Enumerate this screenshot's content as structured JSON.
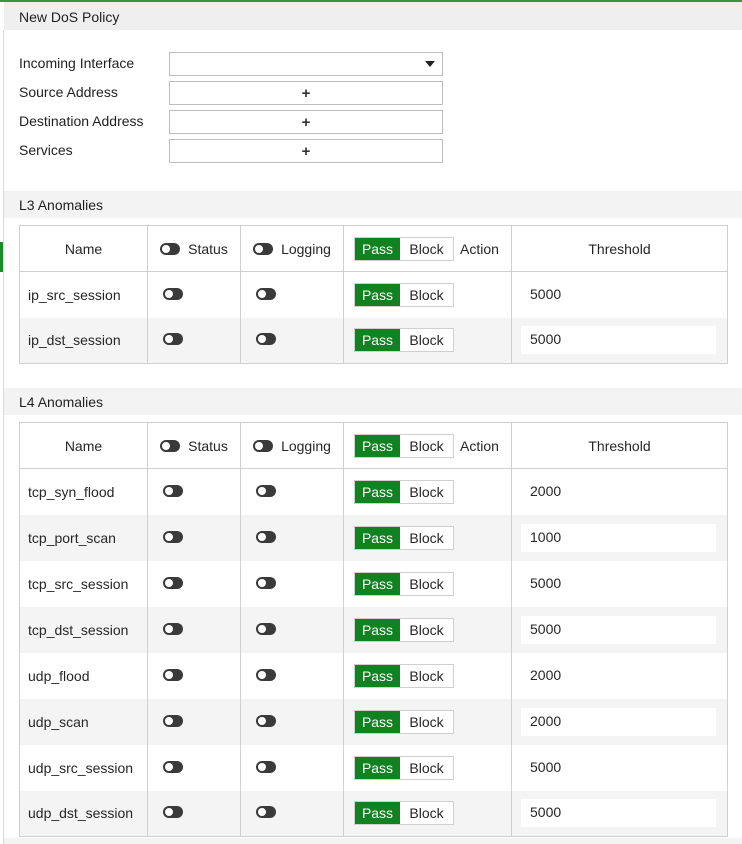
{
  "title": "New DoS Policy",
  "form": {
    "incoming_interface": {
      "label": "Incoming Interface",
      "value": ""
    },
    "source_address": {
      "label": "Source Address",
      "icon": "plus-icon",
      "glyph": "+"
    },
    "destination_address": {
      "label": "Destination Address",
      "icon": "plus-icon",
      "glyph": "+"
    },
    "services": {
      "label": "Services",
      "icon": "plus-icon",
      "glyph": "+"
    }
  },
  "columns": {
    "name": "Name",
    "status": "Status",
    "logging": "Logging",
    "pass": "Pass",
    "block": "Block",
    "action": "Action",
    "threshold": "Threshold"
  },
  "l3": {
    "title": "L3 Anomalies",
    "rows": [
      {
        "name": "ip_src_session",
        "action": "Pass",
        "threshold": "5000"
      },
      {
        "name": "ip_dst_session",
        "action": "Pass",
        "threshold": "5000"
      }
    ]
  },
  "l4": {
    "title": "L4 Anomalies",
    "rows": [
      {
        "name": "tcp_syn_flood",
        "action": "Pass",
        "threshold": "2000"
      },
      {
        "name": "tcp_port_scan",
        "action": "Pass",
        "threshold": "1000"
      },
      {
        "name": "tcp_src_session",
        "action": "Pass",
        "threshold": "5000"
      },
      {
        "name": "tcp_dst_session",
        "action": "Pass",
        "threshold": "5000"
      },
      {
        "name": "udp_flood",
        "action": "Pass",
        "threshold": "2000"
      },
      {
        "name": "udp_scan",
        "action": "Pass",
        "threshold": "2000"
      },
      {
        "name": "udp_src_session",
        "action": "Pass",
        "threshold": "5000"
      },
      {
        "name": "udp_dst_session",
        "action": "Pass",
        "threshold": "5000"
      }
    ]
  },
  "colors": {
    "pass_green": "#10821f",
    "accent_green": "#2e9a3c",
    "border": "#cfcfcf"
  }
}
